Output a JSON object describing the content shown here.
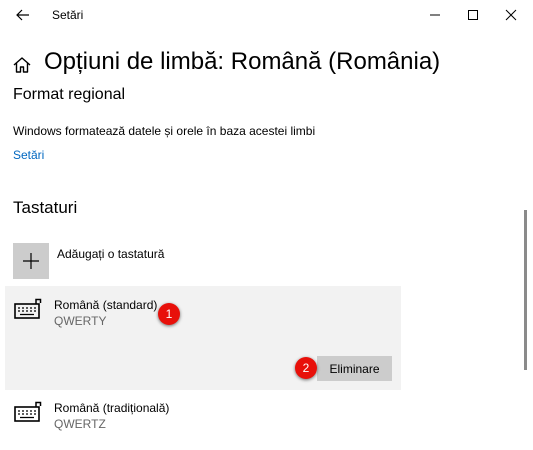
{
  "window": {
    "title": "Setări",
    "controls": {
      "minimize": "minimize-icon",
      "maximize": "maximize-icon",
      "close": "close-icon"
    }
  },
  "page": {
    "title": "Opțiuni de limbă: Română (România)",
    "home_icon": "home-icon"
  },
  "regional_format": {
    "heading": "Format regional",
    "description": "Windows formatează datele și orele în baza acestei limbi",
    "settings_link": "Setări"
  },
  "keyboards": {
    "heading": "Tastaturi",
    "add_label": "Adăugați o tastatură",
    "items": [
      {
        "name": "Română (standard)",
        "layout": "QWERTY",
        "selected": true
      },
      {
        "name": "Română (tradițională)",
        "layout": "QWERTZ",
        "selected": false
      }
    ],
    "remove_button": "Eliminare"
  },
  "annotations": [
    {
      "label": "1",
      "color": "#e8100a"
    },
    {
      "label": "2",
      "color": "#e8100a"
    }
  ],
  "colors": {
    "link": "#0067c0",
    "selected_bg": "#f2f2f2",
    "button_bg": "#cccccc",
    "badge": "#e8100a"
  }
}
